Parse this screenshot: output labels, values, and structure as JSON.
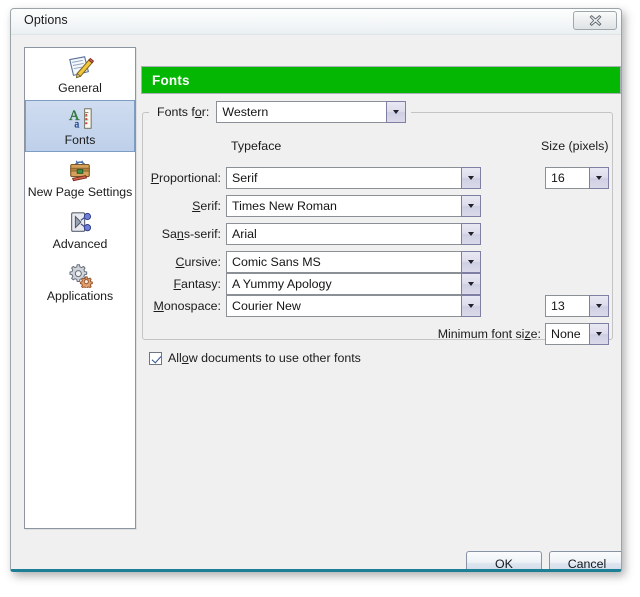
{
  "window": {
    "title": "Options",
    "close_icon": "close-icon"
  },
  "sidebar": {
    "items": [
      {
        "label": "General",
        "icon": "notepad-pencil-icon",
        "selected": false
      },
      {
        "label": "Fonts",
        "icon": "font-ruler-icon",
        "selected": true
      },
      {
        "label": "New Page Settings",
        "icon": "toolbox-icon",
        "selected": false
      },
      {
        "label": "Advanced",
        "icon": "switch-node-icon",
        "selected": false
      },
      {
        "label": "Applications",
        "icon": "gears-icon",
        "selected": false
      }
    ]
  },
  "panel": {
    "header_title": "Fonts",
    "header_color": "#03b703",
    "fonts_for": {
      "label": "Fonts ",
      "label_accel": "f",
      "label_tail": "or:",
      "value": "Western"
    },
    "columns": {
      "typeface": "Typeface",
      "size": "Size (pixels)"
    },
    "rows": [
      {
        "label_pre": "",
        "label_accel": "P",
        "label_post": "roportional:",
        "value": "Serif",
        "size": "16",
        "has_size": true
      },
      {
        "label_pre": "",
        "label_accel": "S",
        "label_post": "erif:",
        "value": "Times New Roman",
        "size": "",
        "has_size": false
      },
      {
        "label_pre": "Sa",
        "label_accel": "n",
        "label_post": "s-serif:",
        "value": "Arial",
        "size": "",
        "has_size": false
      },
      {
        "label_pre": "",
        "label_accel": "C",
        "label_post": "ursive:",
        "value": "Comic Sans MS",
        "size": "",
        "has_size": false
      },
      {
        "label_pre": "",
        "label_accel": "F",
        "label_post": "antasy:",
        "value": "A Yummy Apology",
        "size": "",
        "has_size": false
      },
      {
        "label_pre": "",
        "label_accel": "M",
        "label_post": "onospace:",
        "value": "Courier New",
        "size": "13",
        "has_size": true
      }
    ],
    "minimum_font_size": {
      "label_pre": "Minimum font si",
      "label_accel": "z",
      "label_post": "e:",
      "value": "None"
    },
    "allow_other_fonts": {
      "label_pre": "All",
      "label_accel": "o",
      "label_post": "w documents to use other fonts",
      "checked": true
    }
  },
  "buttons": {
    "ok": "OK",
    "cancel": "Cancel"
  }
}
